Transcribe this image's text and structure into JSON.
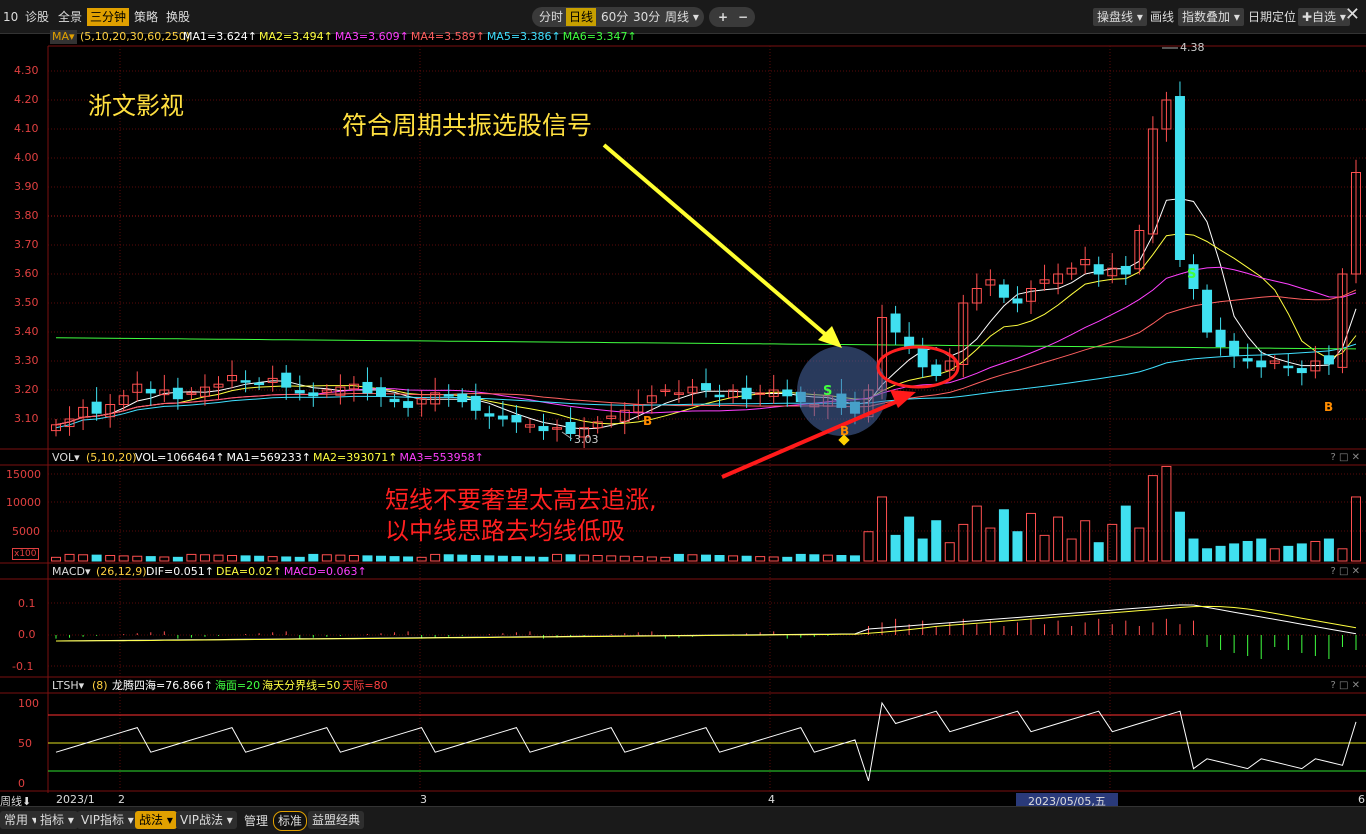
{
  "toolbar": {
    "code_frag": "10",
    "left_items": [
      "诊股",
      "全景",
      "三分钟",
      "策略",
      "换股"
    ],
    "active_left": "三分钟",
    "periods": [
      "分时",
      "日线",
      "60分",
      "30分",
      "周线 ▾"
    ],
    "active_period": "日线",
    "zoom_in": "+",
    "zoom_out": "−",
    "right_items": [
      "操盘线 ▾",
      "画线",
      "指数叠加 ▾",
      "日期定位",
      "✚自选 ▾"
    ],
    "close": "✕"
  },
  "ma_header": {
    "name": "MA▾",
    "params": "(5,10,20,30,60,250)",
    "values": [
      {
        "label": "MA1=3.624↑",
        "color": "#ffffff"
      },
      {
        "label": "MA2=3.494↑",
        "color": "#ffff40"
      },
      {
        "label": "MA3=3.609↑",
        "color": "#ff40ff"
      },
      {
        "label": "MA4=3.589↑",
        "color": "#ff6060"
      },
      {
        "label": "MA5=3.386↑",
        "color": "#40e0ff"
      },
      {
        "label": "MA6=3.347↑",
        "color": "#40ff40"
      }
    ]
  },
  "price_axis": [
    "4.30",
    "4.20",
    "4.10",
    "4.00",
    "3.90",
    "3.80",
    "3.70",
    "3.60",
    "3.50",
    "3.40",
    "3.30",
    "3.20",
    "3.10"
  ],
  "stock_name": "浙文影视",
  "annotation_top": "符合周期共振选股信号",
  "annotation_bottom_1": "短线不要奢望太高去追涨,",
  "annotation_bottom_2": "以中线思路去均线低吸",
  "high_label": "4.38",
  "low_label": "3.03",
  "signal_s": "S",
  "signal_b": "B",
  "vol_header": {
    "name": "VOL▾",
    "params": "(5,10,20)",
    "values": [
      {
        "label": "VOL=1066464↑",
        "color": "#ffffff"
      },
      {
        "label": "MA1=569233↑",
        "color": "#ffffff"
      },
      {
        "label": "MA2=393071↑",
        "color": "#ffff40"
      },
      {
        "label": "MA3=553958↑",
        "color": "#ff40ff"
      }
    ]
  },
  "vol_axis": [
    "15000",
    "10000",
    "5000"
  ],
  "vol_unit": "x100",
  "macd_header": {
    "name": "MACD▾",
    "params": "(26,12,9)",
    "values": [
      {
        "label": "DIF=0.051↑",
        "color": "#ffffff"
      },
      {
        "label": "DEA=0.02↑",
        "color": "#ffff40"
      },
      {
        "label": "MACD=0.063↑",
        "color": "#ff40ff"
      }
    ]
  },
  "macd_axis": [
    "0.1",
    "0.0",
    "-0.1"
  ],
  "ltsh_header": {
    "name": "LTSH▾",
    "params": "(8)",
    "values": [
      {
        "label": "龙腾四海=76.866↑",
        "color": "#ffffff"
      },
      {
        "label": "海面=20",
        "color": "#40ff40"
      },
      {
        "label": "海天分界线=50",
        "color": "#ffff40"
      },
      {
        "label": "天际=80",
        "color": "#ff4040"
      }
    ]
  },
  "ltsh_axis": [
    "100",
    "50",
    "0"
  ],
  "panel_controls": "? □ ✕",
  "x_axis": {
    "left_label": "周线⬇",
    "ticks": [
      "2023/1",
      "2",
      "3",
      "4",
      "6"
    ],
    "cursor_date": "2023/05/05,五"
  },
  "bottom_bar": {
    "items": [
      "常用 ▾",
      "指标 ▾",
      "VIP指标 ▾",
      "战法 ▾",
      "VIP战法 ▾",
      "管理",
      "标准",
      "益盟经典"
    ],
    "active": "战法",
    "ringed": "标准"
  },
  "colors": {
    "up": "#ff5050",
    "down": "#40e0f0",
    "bg": "#000000",
    "accent": "#e0a000"
  }
}
